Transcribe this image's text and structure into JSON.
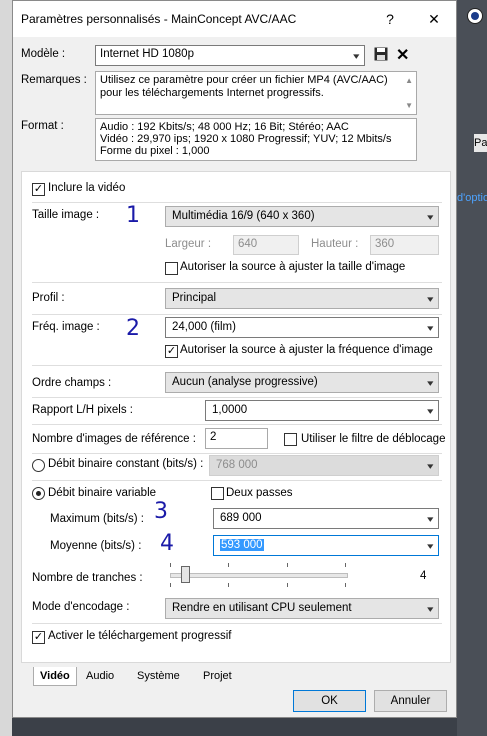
{
  "background": {
    "fragments": [
      "Pa",
      "d'optio"
    ]
  },
  "dialog": {
    "title": "Paramètres personnalisés - MainConcept AVC/AAC",
    "help_label": "?",
    "close_label": "✕"
  },
  "template": {
    "model_label": "Modèle :",
    "model_value": "Internet HD 1080p",
    "remarks_label": "Remarques :",
    "remarks_text": "Utilisez ce paramètre pour créer un fichier MP4 (AVC/AAC) pour les téléchargements Internet progressifs.",
    "format_label": "Format :",
    "format_lines": [
      "Audio : 192 Kbits/s; 48 000 Hz; 16 Bit; Stéréo; AAC",
      "Vidéo : 29,970 ips; 1920 x 1080 Progressif; YUV; 12 Mbits/s",
      "Forme du pixel : 1,000"
    ]
  },
  "video": {
    "include_video_label": "Inclure la vidéo",
    "include_video_checked": true,
    "image_size_label": "Taille image :",
    "image_size_value": "Multimédia 16/9 (640 x 360)",
    "width_label": "Largeur :",
    "width_value": "640",
    "height_label": "Hauteur :",
    "height_value": "360",
    "allow_size_label": "Autoriser la source à ajuster la taille d'image",
    "allow_size_checked": false,
    "profile_label": "Profil :",
    "profile_value": "Principal",
    "framerate_label": "Fréq. image :",
    "framerate_value": "24,000 (film)",
    "allow_framerate_label": "Autoriser la source à ajuster la fréquence d'image",
    "allow_framerate_checked": true,
    "field_order_label": "Ordre champs :",
    "field_order_value": "Aucun (analyse progressive)",
    "pixel_ratio_label": "Rapport L/H pixels :",
    "pixel_ratio_value": "1,0000",
    "ref_frames_label": "Nombre d'images de référence :",
    "ref_frames_value": "2",
    "deblock_label": "Utiliser le filtre de déblocage",
    "deblock_checked": false,
    "cbr_label": "Débit binaire constant (bits/s) :",
    "cbr_value": "768 000",
    "vbr_label": "Débit binaire variable",
    "two_pass_label": "Deux passes",
    "two_pass_checked": false,
    "max_label": "Maximum (bits/s) :",
    "max_value": "689 000",
    "avg_label": "Moyenne (bits/s) :",
    "avg_value": "593 000",
    "slices_label": "Nombre de tranches :",
    "slices_value": "4",
    "encode_mode_label": "Mode d'encodage :",
    "encode_mode_value": "Rendre en utilisant CPU seulement",
    "progressive_label": "Activer le téléchargement progressif",
    "progressive_checked": true
  },
  "annotations": [
    "1",
    "2",
    "3",
    "4"
  ],
  "tabs": [
    "Vidéo",
    "Audio",
    "Système",
    "Projet"
  ],
  "buttons": {
    "ok": "OK",
    "cancel": "Annuler"
  }
}
